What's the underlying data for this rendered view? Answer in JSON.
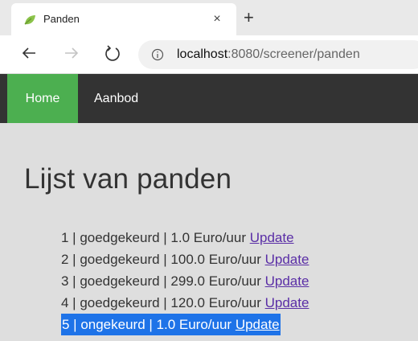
{
  "browser": {
    "tab_title": "Panden",
    "tab_close": "×",
    "new_tab": "+",
    "url_host": "localhost",
    "url_rest": ":8080/screener/panden"
  },
  "navbar": {
    "home": "Home",
    "aanbod": "Aanbod"
  },
  "main": {
    "heading": "Lijst van panden",
    "items": [
      {
        "text": "1 | goedgekeurd | 1.0 Euro/uur ",
        "link": "Update"
      },
      {
        "text": "2 | goedgekeurd | 100.0 Euro/uur ",
        "link": "Update"
      },
      {
        "text": "3 | goedgekeurd | 299.0 Euro/uur ",
        "link": "Update"
      },
      {
        "text": "4 | goedgekeurd | 120.0 Euro/uur ",
        "link": "Update"
      },
      {
        "text": "5 | ongekeurd | 1.0 Euro/uur ",
        "link": "Update"
      }
    ]
  },
  "colors": {
    "navbar_bg": "#333333",
    "home_active": "#4caf50",
    "page_bg": "#dedede",
    "link": "#5a2ea6",
    "selection": "#1e73e8"
  },
  "icons": {
    "favicon": "leaf-icon",
    "back": "back-arrow-icon",
    "forward": "forward-arrow-icon",
    "reload": "reload-icon",
    "info": "info-icon"
  }
}
